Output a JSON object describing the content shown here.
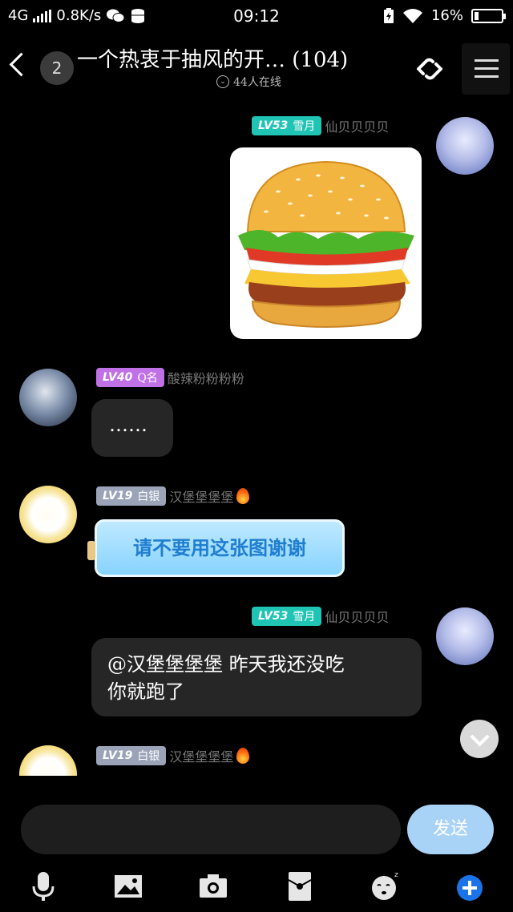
{
  "status_bar": {
    "network": "4G",
    "speed": "0.8K/s",
    "time": "09:12",
    "battery": "16%",
    "battery_level": 0.16
  },
  "header": {
    "unread_count": "2",
    "group_title": "一个热衷于抽风的开…  (104)",
    "online_text": "44人在线"
  },
  "messages": [
    {
      "side": "right",
      "level": "LV53",
      "title": "雪月",
      "nickname": "仙贝贝贝贝",
      "type": "image",
      "image_desc": "burger-image"
    },
    {
      "side": "left",
      "level": "LV40",
      "title": "Q名",
      "nickname": "酸辣粉粉粉粉",
      "type": "text",
      "text": "……"
    },
    {
      "side": "left",
      "level": "LV19",
      "title": "白银",
      "nickname": "汉堡堡堡堡",
      "type": "bottle",
      "text": "请不要用这张图谢谢"
    },
    {
      "side": "right",
      "level": "LV53",
      "title": "雪月",
      "nickname": "仙贝贝贝贝",
      "type": "text",
      "text_line1": "@汉堡堡堡堡 昨天我还没吃",
      "text_line2": "你就跑了"
    },
    {
      "side": "left",
      "level": "LV19",
      "title": "白银",
      "nickname": "汉堡堡堡堡",
      "type": "partial"
    }
  ],
  "input": {
    "placeholder": ""
  },
  "send_label": "发送",
  "toolbar_icons": [
    "microphone-icon",
    "image-icon",
    "camera-icon",
    "red-packet-icon",
    "emoji-icon",
    "plus-icon"
  ],
  "colors": {
    "accent": "#1a73e8",
    "teal_badge": "#1fc4b4",
    "purple_badge": "#c071e6",
    "gray_badge": "#9aa3b8",
    "send_button": "#a9d2f7"
  }
}
